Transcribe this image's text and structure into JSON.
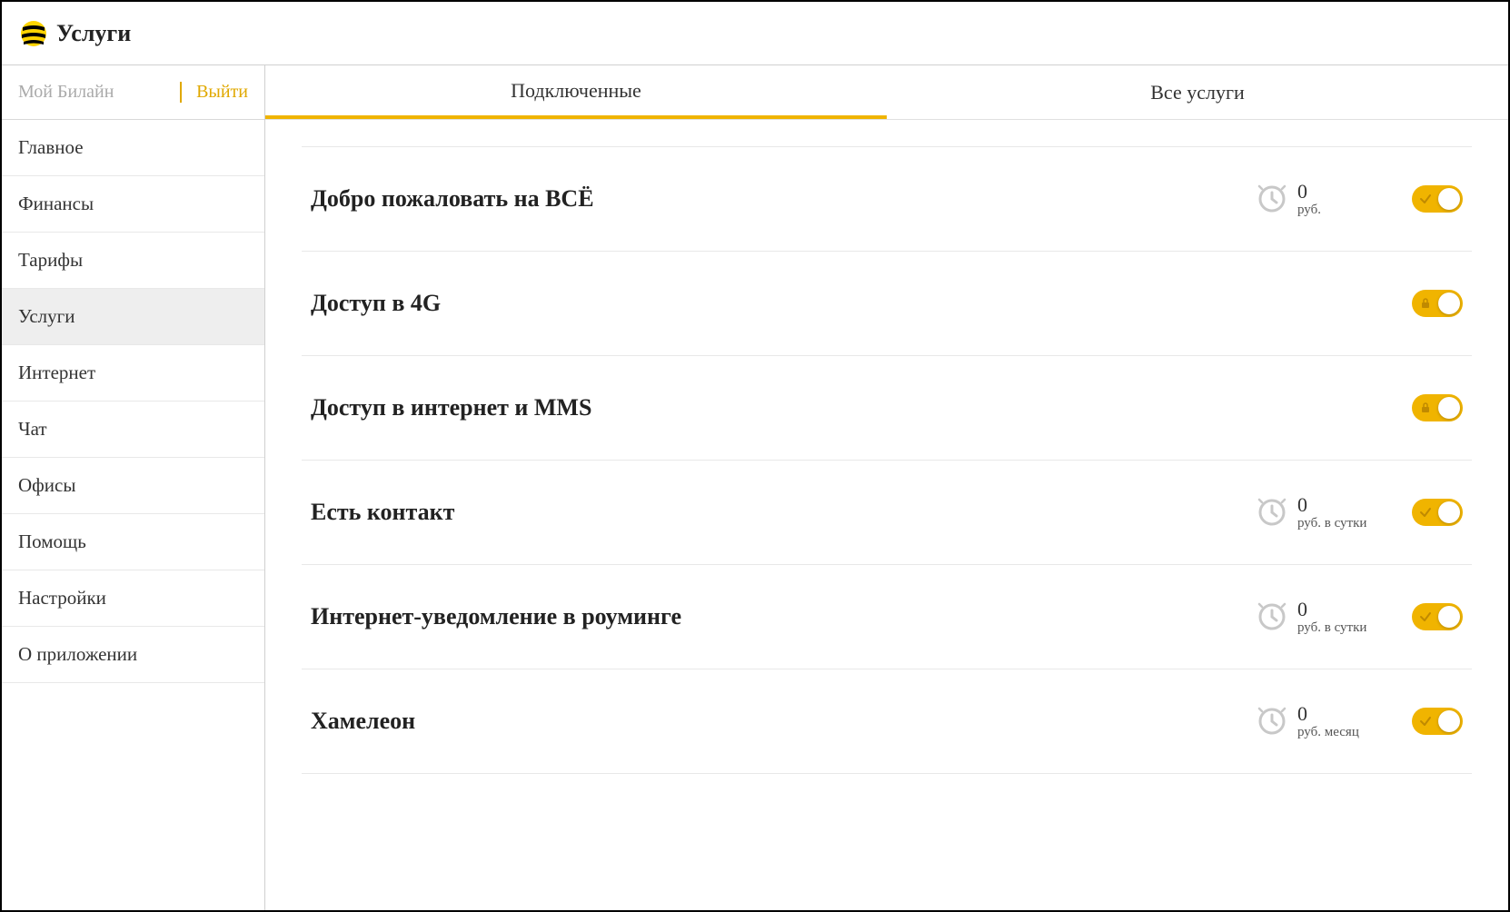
{
  "header": {
    "title": "Услуги"
  },
  "sidebar": {
    "account_label": "Мой Билайн",
    "logout_label": "Выйти",
    "items": [
      {
        "label": "Главное",
        "active": false
      },
      {
        "label": "Финансы",
        "active": false
      },
      {
        "label": "Тарифы",
        "active": false
      },
      {
        "label": "Услуги",
        "active": true
      },
      {
        "label": "Интернет",
        "active": false
      },
      {
        "label": "Чат",
        "active": false
      },
      {
        "label": "Офисы",
        "active": false
      },
      {
        "label": "Помощь",
        "active": false
      },
      {
        "label": "Настройки",
        "active": false
      },
      {
        "label": "О приложении",
        "active": false
      }
    ]
  },
  "tabs": [
    {
      "label": "Подключенные",
      "active": true
    },
    {
      "label": "Все услуги",
      "active": false
    }
  ],
  "services": [
    {
      "title": "Добро пожаловать на ВСЁ",
      "price_value": "0",
      "price_unit": "руб.",
      "show_price": true,
      "locked": false,
      "enabled": true
    },
    {
      "title": "Доступ в 4G",
      "price_value": "",
      "price_unit": "",
      "show_price": false,
      "locked": true,
      "enabled": true
    },
    {
      "title": "Доступ в интернет и MMS",
      "price_value": "",
      "price_unit": "",
      "show_price": false,
      "locked": true,
      "enabled": true
    },
    {
      "title": "Есть контакт",
      "price_value": "0",
      "price_unit": "руб. в сутки",
      "show_price": true,
      "locked": false,
      "enabled": true
    },
    {
      "title": "Интернет-уведомление в роуминге",
      "price_value": "0",
      "price_unit": "руб. в сутки",
      "show_price": true,
      "locked": false,
      "enabled": true
    },
    {
      "title": "Хамелеон",
      "price_value": "0",
      "price_unit": "руб. месяц",
      "show_price": true,
      "locked": false,
      "enabled": true
    }
  ],
  "colors": {
    "accent": "#f0b400"
  }
}
